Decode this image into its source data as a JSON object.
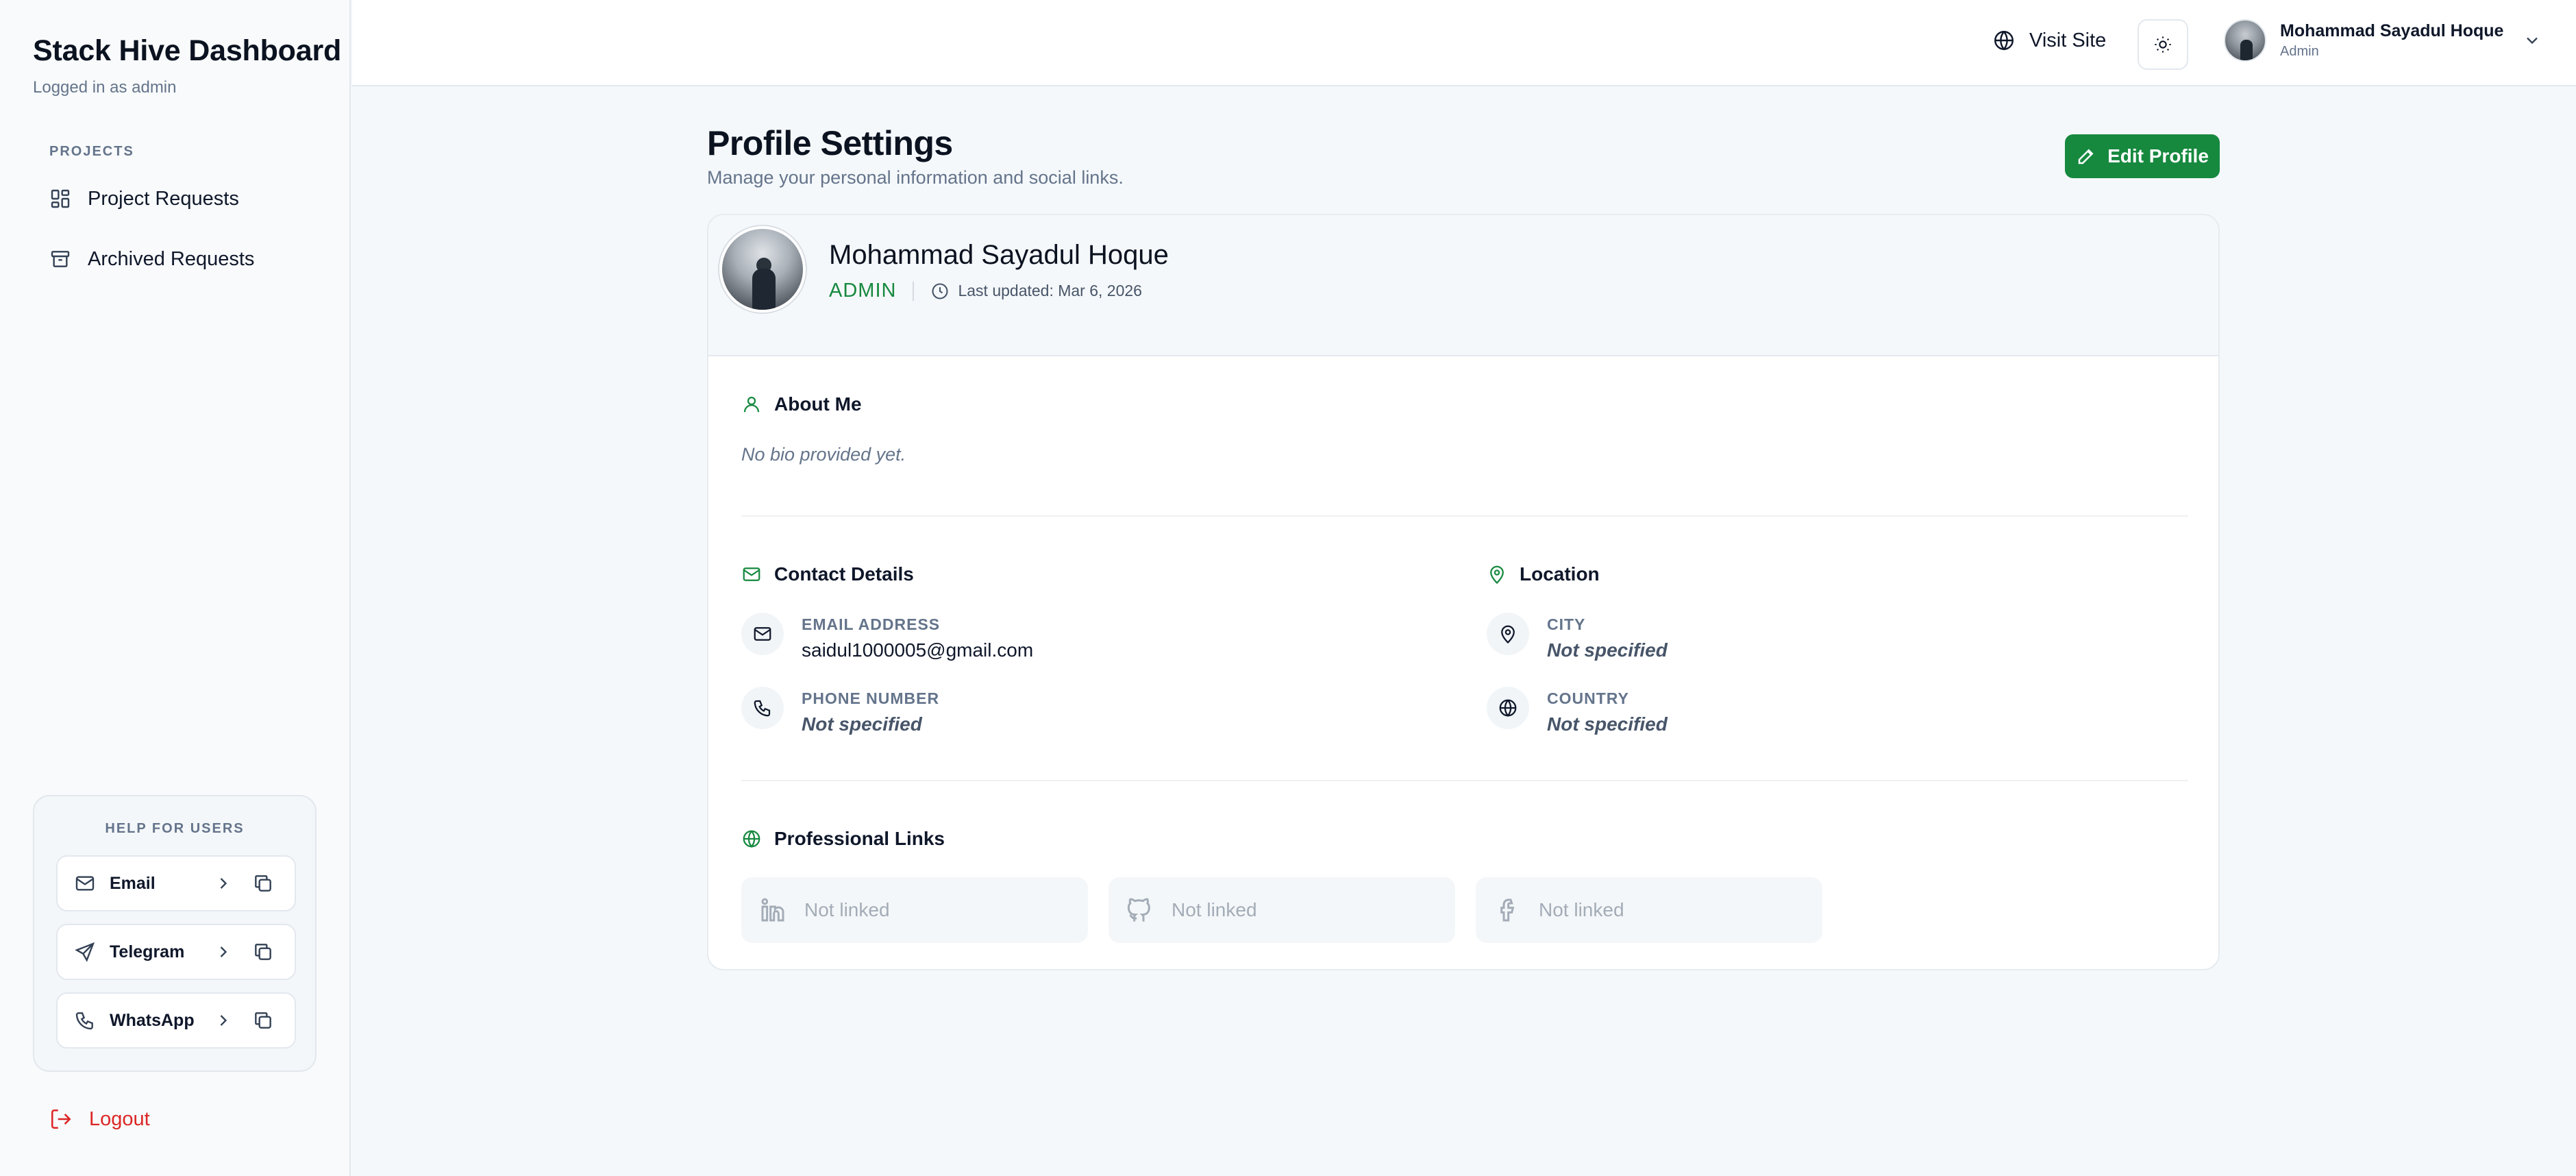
{
  "sidebar": {
    "brand": "Stack Hive Dashboard",
    "logged_in": "Logged in as admin",
    "section_label": "PROJECTS",
    "items": [
      {
        "label": "Project Requests",
        "icon": "grid-icon"
      },
      {
        "label": "Archived Requests",
        "icon": "archive-icon"
      }
    ],
    "help": {
      "title": "HELP FOR USERS",
      "rows": [
        {
          "label": "Email",
          "icon": "mail-icon"
        },
        {
          "label": "Telegram",
          "icon": "send-icon"
        },
        {
          "label": "WhatsApp",
          "icon": "phone-icon"
        }
      ]
    },
    "logout_label": "Logout"
  },
  "topbar": {
    "visit_label": "Visit Site",
    "user_name": "Mohammad Sayadul Hoque",
    "user_role": "Admin"
  },
  "page": {
    "title": "Profile Settings",
    "subtitle": "Manage your personal information and social links.",
    "edit_label": "Edit Profile"
  },
  "profile": {
    "name": "Mohammad Sayadul Hoque",
    "role": "ADMIN",
    "updated": "Last updated: Mar 6, 2026"
  },
  "about": {
    "heading": "About Me",
    "bio": "No bio provided yet."
  },
  "contact": {
    "heading": "Contact Details",
    "email_label": "EMAIL ADDRESS",
    "email_value": "saidul1000005@gmail.com",
    "phone_label": "PHONE NUMBER",
    "phone_value": "Not specified"
  },
  "location": {
    "heading": "Location",
    "city_label": "CITY",
    "city_value": "Not specified",
    "country_label": "COUNTRY",
    "country_value": "Not specified"
  },
  "links": {
    "heading": "Professional Links",
    "items": [
      {
        "label": "Not linked",
        "icon": "linkedin-icon"
      },
      {
        "label": "Not linked",
        "icon": "github-icon"
      },
      {
        "label": "Not linked",
        "icon": "facebook-icon"
      }
    ]
  },
  "colors": {
    "accent": "#16893f",
    "danger": "#dc2626",
    "muted": "#64748b"
  }
}
